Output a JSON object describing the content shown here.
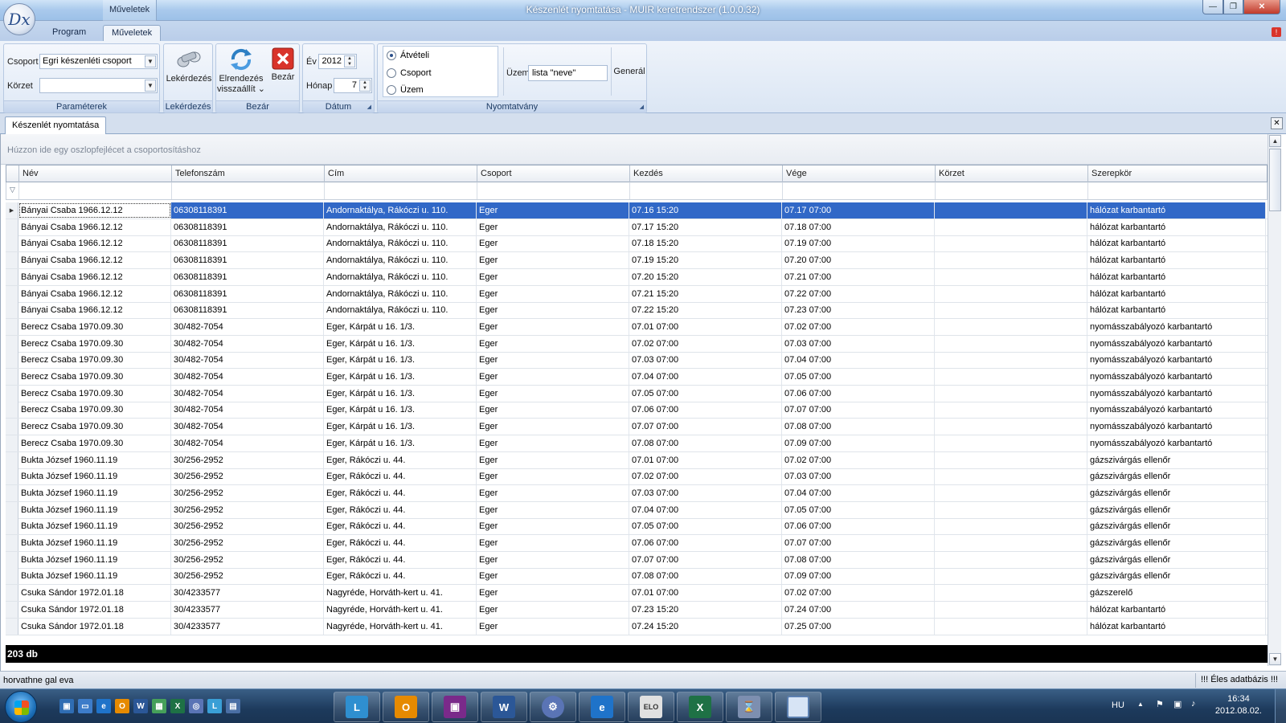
{
  "window": {
    "title": "Készenlét nyomtatása - MUIR keretrendszer (1.0.0.32)",
    "qat_title": "Műveletek",
    "orb_label": "Dx"
  },
  "ribbon": {
    "tabs": [
      "Program",
      "Műveletek"
    ],
    "active_tab": "Műveletek",
    "groups": {
      "parameters": {
        "label": "Paraméterek",
        "csoport_label": "Csoport",
        "csoport_value": "Egri készenléti csoport",
        "korzet_label": "Körzet",
        "korzet_value": ""
      },
      "query": {
        "label": "Lekérdezés",
        "button": "Lekérdezés"
      },
      "close": {
        "label": "Bezár",
        "arrange_line1": "Elrendezés",
        "arrange_line2": "visszaállít ⌄",
        "close_button": "Bezár"
      },
      "date": {
        "label": "Dátum",
        "year_label": "Év",
        "year_value": "2012",
        "month_label": "Hónap",
        "month_value": "7"
      },
      "form": {
        "label": "Nyomtatvány",
        "radios": [
          {
            "label": "Átvételi",
            "checked": true
          },
          {
            "label": "Csoport",
            "checked": false
          },
          {
            "label": "Üzem",
            "checked": false
          }
        ],
        "uzem_label": "Üzem",
        "uzem_value": "lista \"neve\"",
        "generate_button": "Generál"
      }
    }
  },
  "document_tab": "Készenlét nyomtatása",
  "grid": {
    "group_panel_text": "Húzzon ide egy oszlopfejlécet a csoportosításhoz",
    "columns": [
      "Név",
      "Telefonszám",
      "Cím",
      "Csoport",
      "Kezdés",
      "Vége",
      "Körzet",
      "Szerepkör"
    ],
    "selected_row": 0,
    "rows": [
      [
        "Bányai Csaba 1966.12.12",
        "06308118391",
        "Andornaktálya, Rákóczi u. 110.",
        "Eger",
        "07.16 15:20",
        "07.17 07:00",
        "",
        "hálózat karbantartó"
      ],
      [
        "Bányai Csaba 1966.12.12",
        "06308118391",
        "Andornaktálya, Rákóczi u. 110.",
        "Eger",
        "07.17 15:20",
        "07.18 07:00",
        "",
        "hálózat karbantartó"
      ],
      [
        "Bányai Csaba 1966.12.12",
        "06308118391",
        "Andornaktálya, Rákóczi u. 110.",
        "Eger",
        "07.18 15:20",
        "07.19 07:00",
        "",
        "hálózat karbantartó"
      ],
      [
        "Bányai Csaba 1966.12.12",
        "06308118391",
        "Andornaktálya, Rákóczi u. 110.",
        "Eger",
        "07.19 15:20",
        "07.20 07:00",
        "",
        "hálózat karbantartó"
      ],
      [
        "Bányai Csaba 1966.12.12",
        "06308118391",
        "Andornaktálya, Rákóczi u. 110.",
        "Eger",
        "07.20 15:20",
        "07.21 07:00",
        "",
        "hálózat karbantartó"
      ],
      [
        "Bányai Csaba 1966.12.12",
        "06308118391",
        "Andornaktálya, Rákóczi u. 110.",
        "Eger",
        "07.21 15:20",
        "07.22 07:00",
        "",
        "hálózat karbantartó"
      ],
      [
        "Bányai Csaba 1966.12.12",
        "06308118391",
        "Andornaktálya, Rákóczi u. 110.",
        "Eger",
        "07.22 15:20",
        "07.23 07:00",
        "",
        "hálózat karbantartó"
      ],
      [
        "Berecz Csaba 1970.09.30",
        "30/482-7054",
        "Eger, Kárpát u 16. 1/3.",
        "Eger",
        "07.01 07:00",
        "07.02 07:00",
        "",
        "nyomásszabályozó karbantartó"
      ],
      [
        "Berecz Csaba 1970.09.30",
        "30/482-7054",
        "Eger, Kárpát u 16. 1/3.",
        "Eger",
        "07.02 07:00",
        "07.03 07:00",
        "",
        "nyomásszabályozó karbantartó"
      ],
      [
        "Berecz Csaba 1970.09.30",
        "30/482-7054",
        "Eger, Kárpát u 16. 1/3.",
        "Eger",
        "07.03 07:00",
        "07.04 07:00",
        "",
        "nyomásszabályozó karbantartó"
      ],
      [
        "Berecz Csaba 1970.09.30",
        "30/482-7054",
        "Eger, Kárpát u 16. 1/3.",
        "Eger",
        "07.04 07:00",
        "07.05 07:00",
        "",
        "nyomásszabályozó karbantartó"
      ],
      [
        "Berecz Csaba 1970.09.30",
        "30/482-7054",
        "Eger, Kárpát u 16. 1/3.",
        "Eger",
        "07.05 07:00",
        "07.06 07:00",
        "",
        "nyomásszabályozó karbantartó"
      ],
      [
        "Berecz Csaba 1970.09.30",
        "30/482-7054",
        "Eger, Kárpát u 16. 1/3.",
        "Eger",
        "07.06 07:00",
        "07.07 07:00",
        "",
        "nyomásszabályozó karbantartó"
      ],
      [
        "Berecz Csaba 1970.09.30",
        "30/482-7054",
        "Eger, Kárpát u 16. 1/3.",
        "Eger",
        "07.07 07:00",
        "07.08 07:00",
        "",
        "nyomásszabályozó karbantartó"
      ],
      [
        "Berecz Csaba 1970.09.30",
        "30/482-7054",
        "Eger, Kárpát u 16. 1/3.",
        "Eger",
        "07.08 07:00",
        "07.09 07:00",
        "",
        "nyomásszabályozó karbantartó"
      ],
      [
        "Bukta József 1960.11.19",
        "30/256-2952",
        "Eger, Rákóczi u. 44.",
        "Eger",
        "07.01 07:00",
        "07.02 07:00",
        "",
        "gázszivárgás ellenőr"
      ],
      [
        "Bukta József 1960.11.19",
        "30/256-2952",
        "Eger, Rákóczi u. 44.",
        "Eger",
        "07.02 07:00",
        "07.03 07:00",
        "",
        "gázszivárgás ellenőr"
      ],
      [
        "Bukta József 1960.11.19",
        "30/256-2952",
        "Eger, Rákóczi u. 44.",
        "Eger",
        "07.03 07:00",
        "07.04 07:00",
        "",
        "gázszivárgás ellenőr"
      ],
      [
        "Bukta József 1960.11.19",
        "30/256-2952",
        "Eger, Rákóczi u. 44.",
        "Eger",
        "07.04 07:00",
        "07.05 07:00",
        "",
        "gázszivárgás ellenőr"
      ],
      [
        "Bukta József 1960.11.19",
        "30/256-2952",
        "Eger, Rákóczi u. 44.",
        "Eger",
        "07.05 07:00",
        "07.06 07:00",
        "",
        "gázszivárgás ellenőr"
      ],
      [
        "Bukta József 1960.11.19",
        "30/256-2952",
        "Eger, Rákóczi u. 44.",
        "Eger",
        "07.06 07:00",
        "07.07 07:00",
        "",
        "gázszivárgás ellenőr"
      ],
      [
        "Bukta József 1960.11.19",
        "30/256-2952",
        "Eger, Rákóczi u. 44.",
        "Eger",
        "07.07 07:00",
        "07.08 07:00",
        "",
        "gázszivárgás ellenőr"
      ],
      [
        "Bukta József 1960.11.19",
        "30/256-2952",
        "Eger, Rákóczi u. 44.",
        "Eger",
        "07.08 07:00",
        "07.09 07:00",
        "",
        "gázszivárgás ellenőr"
      ],
      [
        "Csuka Sándor 1972.01.18",
        "30/4233577",
        "Nagyréde, Horváth-kert u. 41.",
        "Eger",
        "07.01 07:00",
        "07.02 07:00",
        "",
        "gázszerelő"
      ],
      [
        "Csuka Sándor 1972.01.18",
        "30/4233577",
        "Nagyréde, Horváth-kert u. 41.",
        "Eger",
        "07.23 15:20",
        "07.24 07:00",
        "",
        "hálózat karbantartó"
      ],
      [
        "Csuka Sándor 1972.01.18",
        "30/4233577",
        "Nagyréde, Horváth-kert u. 41.",
        "Eger",
        "07.24 15:20",
        "07.25 07:00",
        "",
        "hálózat karbantartó"
      ]
    ],
    "footer_count": "203 db"
  },
  "status": {
    "user": "horvathne gal eva",
    "db": "!!! Éles adatbázis !!!"
  },
  "taskbar": {
    "lang": "HU",
    "time": "16:34",
    "date": "2012.08.02.",
    "elo_label": "ELO"
  },
  "colors": {
    "selection": "#3168c7",
    "footer": "#000000",
    "title_gradient_top": "#cfe3f7"
  }
}
